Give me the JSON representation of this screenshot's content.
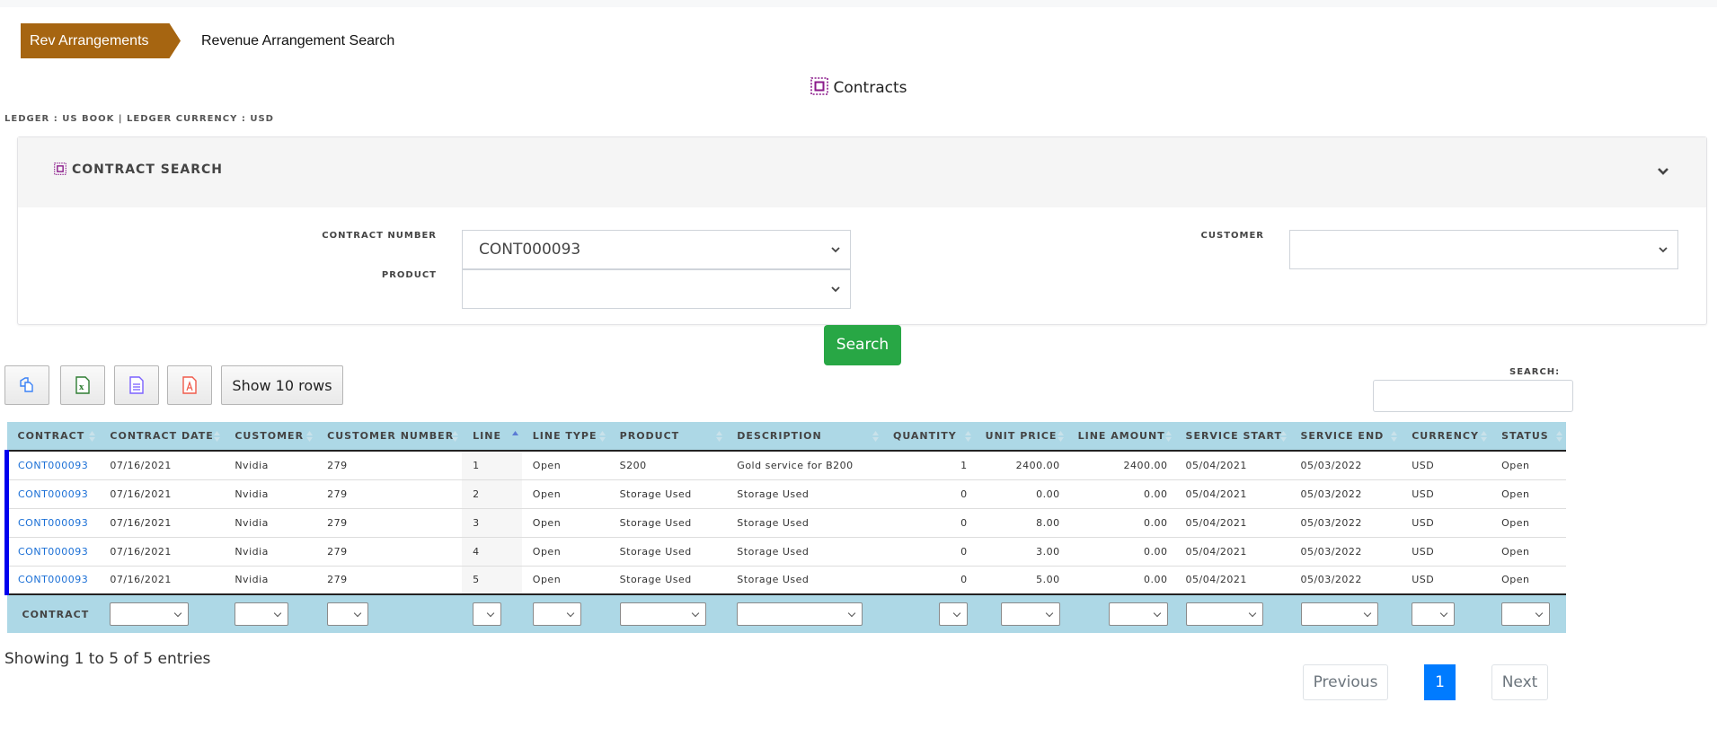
{
  "breadcrumb": {
    "root": "Rev Arrangements",
    "current": "Revenue Arrangement Search",
    "root_color": "#a66511"
  },
  "page_title": "Contracts",
  "ledger_info": "LEDGER : US BOOK | LEDGER CURRENCY : USD",
  "search_panel": {
    "title": "CONTRACT SEARCH",
    "fields": {
      "contract_number": {
        "label": "CONTRACT NUMBER",
        "value": "CONT000093"
      },
      "product": {
        "label": "PRODUCT",
        "value": ""
      },
      "customer": {
        "label": "CUSTOMER",
        "value": ""
      }
    },
    "search_button": "Search",
    "search_button_color": "#28a745"
  },
  "toolbar": {
    "buttons": [
      {
        "icon": "copy-icon",
        "label": ""
      },
      {
        "icon": "excel-icon",
        "label": ""
      },
      {
        "icon": "csv-icon",
        "label": ""
      },
      {
        "icon": "pdf-icon",
        "label": ""
      }
    ],
    "page_length_label": "Show 10 rows"
  },
  "table_search": {
    "label": "SEARCH:",
    "value": ""
  },
  "table": {
    "header_color": "#add8e6",
    "columns": [
      "CONTRACT",
      "CONTRACT DATE",
      "CUSTOMER",
      "CUSTOMER NUMBER",
      "LINE",
      "LINE TYPE",
      "PRODUCT",
      "DESCRIPTION",
      "QUANTITY",
      "UNIT PRICE",
      "LINE AMOUNT",
      "SERVICE START",
      "SERVICE END",
      "CURRENCY",
      "STATUS"
    ],
    "sorted_column": "LINE",
    "sort_direction": "ascending",
    "rows": [
      [
        "CONT000093",
        "07/16/2021",
        "Nvidia",
        "279",
        "1",
        "Open",
        "S200",
        "Gold service for B200",
        "1",
        "2400.00",
        "2400.00",
        "05/04/2021",
        "05/03/2022",
        "USD",
        "Open"
      ],
      [
        "CONT000093",
        "07/16/2021",
        "Nvidia",
        "279",
        "2",
        "Open",
        "Storage Used",
        "Storage Used",
        "0",
        "0.00",
        "0.00",
        "05/04/2021",
        "05/03/2022",
        "USD",
        "Open"
      ],
      [
        "CONT000093",
        "07/16/2021",
        "Nvidia",
        "279",
        "3",
        "Open",
        "Storage Used",
        "Storage Used",
        "0",
        "8.00",
        "0.00",
        "05/04/2021",
        "05/03/2022",
        "USD",
        "Open"
      ],
      [
        "CONT000093",
        "07/16/2021",
        "Nvidia",
        "279",
        "4",
        "Open",
        "Storage Used",
        "Storage Used",
        "0",
        "3.00",
        "0.00",
        "05/04/2021",
        "05/03/2022",
        "USD",
        "Open"
      ],
      [
        "CONT000093",
        "07/16/2021",
        "Nvidia",
        "279",
        "5",
        "Open",
        "Storage Used",
        "Storage Used",
        "0",
        "5.00",
        "0.00",
        "05/04/2021",
        "05/03/2022",
        "USD",
        "Open"
      ]
    ],
    "footer_label": "CONTRACT"
  },
  "info": "Showing 1 to 5 of 5 entries",
  "pagination": {
    "previous": "Previous",
    "current": "1",
    "next": "Next",
    "active_color": "#007bff"
  }
}
